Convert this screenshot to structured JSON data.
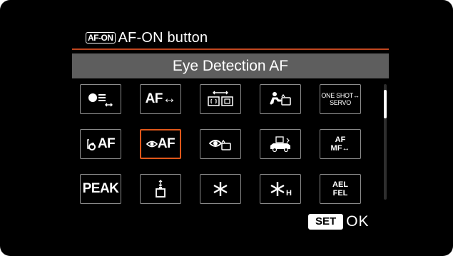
{
  "header": {
    "button_badge": "AF-ON",
    "title": "AF-ON button"
  },
  "current_function": "Eye Detection AF",
  "grid": {
    "rows": [
      [
        {
          "name": "subject-detection-icon",
          "label": ""
        },
        {
          "name": "af-switch-cell",
          "label": "AF↔"
        },
        {
          "name": "af-area-switch-icon",
          "label": ""
        },
        {
          "name": "subject-switch-icon",
          "label": ""
        },
        {
          "name": "oneshot-servo-cell",
          "label_line1": "ONE SHOT↔",
          "label_line2": "SERVO"
        }
      ],
      [
        {
          "name": "eye-af-select-icon",
          "label": "AF"
        },
        {
          "name": "eye-detection-af-icon",
          "label": "AF",
          "selected": true
        },
        {
          "name": "eye-switch-icon",
          "label": ""
        },
        {
          "name": "vehicle-icon",
          "label": ""
        },
        {
          "name": "af-mf-cell",
          "label_line1": "AF",
          "label_line2": "MF↔"
        }
      ],
      [
        {
          "name": "peak-cell",
          "label": "PEAK"
        },
        {
          "name": "depth-preview-icon",
          "label": ""
        },
        {
          "name": "ae-lock-icon",
          "label": ""
        },
        {
          "name": "ae-lock-hold-icon",
          "label": "H"
        },
        {
          "name": "ael-fel-cell",
          "label_line1": "AEL",
          "label_line2": "FEL"
        }
      ]
    ]
  },
  "footer": {
    "set_label": "SET",
    "ok_label": "OK"
  },
  "colors": {
    "background": "#000000",
    "accent": "#e0571a",
    "function_bar": "#5e5e5e",
    "cell_border": "#8c8c8c"
  }
}
